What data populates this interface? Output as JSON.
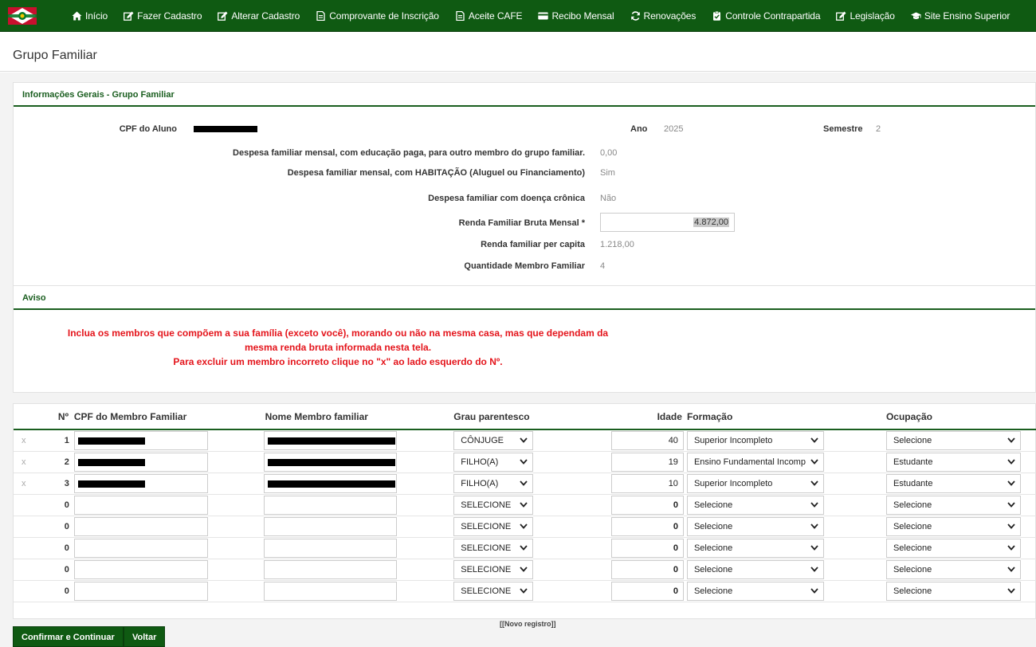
{
  "nav": {
    "items": [
      {
        "label": "Início",
        "icon": "home-icon"
      },
      {
        "label": "Fazer Cadastro",
        "icon": "edit-icon"
      },
      {
        "label": "Alterar Cadastro",
        "icon": "edit-icon"
      },
      {
        "label": "Comprovante de Inscrição",
        "icon": "document-icon"
      },
      {
        "label": "Aceite CAFE",
        "icon": "document-icon"
      },
      {
        "label": "Recibo Mensal",
        "icon": "card-icon"
      },
      {
        "label": "Renovações",
        "icon": "refresh-icon"
      },
      {
        "label": "Controle Contrapartida",
        "icon": "clipboard-check-icon"
      },
      {
        "label": "Legislação",
        "icon": "edit-icon"
      },
      {
        "label": "Site Ensino Superior",
        "icon": "graduation-cap-icon"
      }
    ]
  },
  "page": {
    "title": "Grupo Familiar"
  },
  "info": {
    "title": "Informações Gerais - Grupo Familiar",
    "cpf_label": "CPF do Aluno",
    "ano_label": "Ano",
    "ano_value": "2025",
    "semestre_label": "Semestre",
    "semestre_value": "2",
    "despesa_edu_label": "Despesa familiar mensal, com educação paga, para outro membro do grupo familiar.",
    "despesa_edu_value": "0,00",
    "despesa_hab_label": "Despesa familiar mensal, com HABITAÇÃO (Aluguel ou Financiamento)",
    "despesa_hab_value": "Sim",
    "doenca_label": "Despesa familiar com doença crônica",
    "doenca_value": "Não",
    "renda_label": "Renda Familiar Bruta Mensal *",
    "renda_value": "4.872,00",
    "per_capita_label": "Renda familiar per capita",
    "per_capita_value": "1.218,00",
    "qtd_label": "Quantidade Membro Familiar",
    "qtd_value": "4"
  },
  "aviso": {
    "title": "Aviso",
    "line1": "Inclua os membros que compõem a sua família (exceto você), morando ou não na mesma casa, mas que dependam da",
    "line2": "mesma renda bruta informada nesta tela.",
    "line3": "Para excluir um membro incorreto clique no \"x\" ao lado esquerdo do Nº."
  },
  "table": {
    "headers": {
      "num": "Nº",
      "cpf": "CPF do Membro Familiar",
      "nome": "Nome Membro familiar",
      "grau": "Grau parentesco",
      "idade": "Idade",
      "formacao": "Formação",
      "ocupacao": "Ocupação"
    },
    "delete_symbol": "x",
    "rows": [
      {
        "num": "1",
        "grau": "CÔNJUGE",
        "idade": "40",
        "formacao": "Superior Incompleto",
        "ocupacao": "Selecione"
      },
      {
        "num": "2",
        "grau": "FILHO(A)",
        "idade": "19",
        "formacao": "Ensino Fundamental Incomp",
        "ocupacao": "Estudante"
      },
      {
        "num": "3",
        "grau": "FILHO(A)",
        "idade": "10",
        "formacao": "Superior Incompleto",
        "ocupacao": "Estudante"
      },
      {
        "num": "0",
        "grau": "SELECIONE",
        "idade": "0",
        "formacao": "Selecione",
        "ocupacao": "Selecione"
      },
      {
        "num": "0",
        "grau": "SELECIONE",
        "idade": "0",
        "formacao": "Selecione",
        "ocupacao": "Selecione"
      },
      {
        "num": "0",
        "grau": "SELECIONE",
        "idade": "0",
        "formacao": "Selecione",
        "ocupacao": "Selecione"
      },
      {
        "num": "0",
        "grau": "SELECIONE",
        "idade": "0",
        "formacao": "Selecione",
        "ocupacao": "Selecione"
      },
      {
        "num": "0",
        "grau": "SELECIONE",
        "idade": "0",
        "formacao": "Selecione",
        "ocupacao": "Selecione"
      }
    ],
    "novo_registro": "[[Novo registro]]"
  },
  "buttons": {
    "confirm": "Confirmar e Continuar",
    "back": "Voltar"
  },
  "colors": {
    "nav_bg": "#0f5a12",
    "accent_green": "#1a5e1f",
    "warning_red": "#e4141b"
  }
}
